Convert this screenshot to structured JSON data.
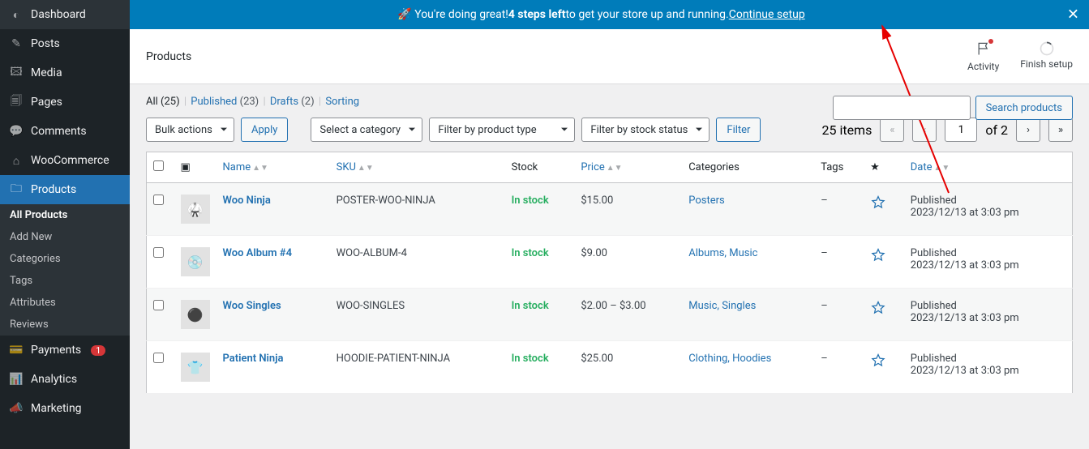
{
  "sidebar": {
    "items": [
      {
        "label": "Dashboard",
        "glyph": "◐"
      },
      {
        "label": "Posts",
        "glyph": "✎"
      },
      {
        "label": "Media",
        "glyph": "🖾"
      },
      {
        "label": "Pages",
        "glyph": "🗐"
      },
      {
        "label": "Comments",
        "glyph": "💬"
      },
      {
        "label": "WooCommerce",
        "glyph": "⌂"
      },
      {
        "label": "Products",
        "glyph": "🗀"
      },
      {
        "label": "Payments",
        "glyph": "💳",
        "badge": "1"
      },
      {
        "label": "Analytics",
        "glyph": "📊"
      },
      {
        "label": "Marketing",
        "glyph": "📣"
      }
    ],
    "submenu": [
      "All Products",
      "Add New",
      "Categories",
      "Tags",
      "Attributes",
      "Reviews"
    ]
  },
  "banner": {
    "emoji": "🚀",
    "pre": "You're doing great! ",
    "bold": "4 steps left",
    "post": " to get your store up and running. ",
    "link": "Continue setup"
  },
  "header": {
    "title": "Products",
    "activity": "Activity",
    "finish": "Finish setup"
  },
  "status": {
    "all_label": "All",
    "all_count": "(25)",
    "published_label": "Published",
    "published_count": "(23)",
    "drafts_label": "Drafts",
    "drafts_count": "(2)",
    "sorting_label": "Sorting"
  },
  "toolbar": {
    "bulk": "Bulk actions",
    "apply": "Apply",
    "category": "Select a category",
    "ptype": "Filter by product type",
    "stock": "Filter by stock status",
    "filter": "Filter",
    "search_btn": "Search products",
    "items_text": "25 items",
    "page": "1",
    "of": "of 2"
  },
  "table": {
    "headers": {
      "name": "Name",
      "sku": "SKU",
      "stock": "Stock",
      "price": "Price",
      "categories": "Categories",
      "tags": "Tags",
      "date": "Date"
    },
    "rows": [
      {
        "thumb": "🥋",
        "name": "Woo Ninja",
        "sku": "POSTER-WOO-NINJA",
        "stock": "In stock",
        "price": "$15.00",
        "cats": "Posters",
        "tags": "–",
        "pub": "Published",
        "date": "2023/12/13 at 3:03 pm"
      },
      {
        "thumb": "💿",
        "name": "Woo Album #4",
        "sku": "WOO-ALBUM-4",
        "stock": "In stock",
        "price": "$9.00",
        "cats": "Albums, Music",
        "tags": "–",
        "pub": "Published",
        "date": "2023/12/13 at 3:03 pm"
      },
      {
        "thumb": "⚫",
        "name": "Woo Singles",
        "sku": "WOO-SINGLES",
        "stock": "In stock",
        "price": "$2.00 – $3.00",
        "cats": "Music, Singles",
        "tags": "–",
        "pub": "Published",
        "date": "2023/12/13 at 3:03 pm"
      },
      {
        "thumb": "👕",
        "name": "Patient Ninja",
        "sku": "HOODIE-PATIENT-NINJA",
        "stock": "In stock",
        "price": "$25.00",
        "cats": "Clothing, Hoodies",
        "tags": "–",
        "pub": "Published",
        "date": "2023/12/13 at 3:03 pm"
      }
    ]
  }
}
